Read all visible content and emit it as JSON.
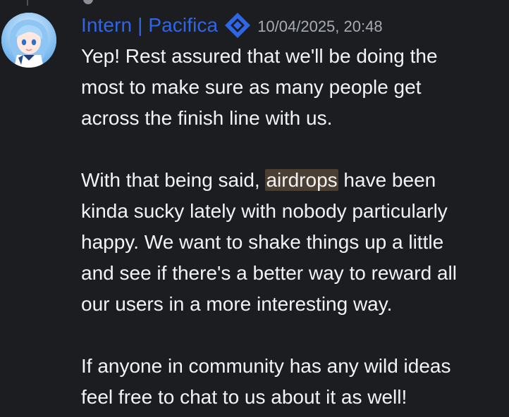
{
  "message": {
    "author": "Intern | Pacifica",
    "timestamp": "10/04/2025, 20:48",
    "paragraphs": [
      {
        "lines": [
          "Yep! Rest assured that we'll be doing the",
          "most to make sure as many people get",
          "across the finish line with us."
        ]
      },
      {
        "line1_before": "With that being said, ",
        "line1_highlight": "airdrops",
        "line1_after": " have been",
        "lines": [
          "kinda sucky lately with nobody particularly",
          "happy. We want to shake things up a little",
          "and see if there's a better way to reward all",
          "our users in a more interesting way."
        ]
      },
      {
        "lines": [
          "If anyone in community has any wild ideas",
          "feel free to chat to us about it as well!"
        ]
      }
    ]
  },
  "colors": {
    "background": "#1c1d21",
    "author": "#2f66e8",
    "highlight": "#4b3f33",
    "text": "#f2f3f5",
    "timestamp": "#a7abb2"
  },
  "icons": {
    "avatar": "anime-character-avatar",
    "badge": "pacifica-logo-icon"
  }
}
